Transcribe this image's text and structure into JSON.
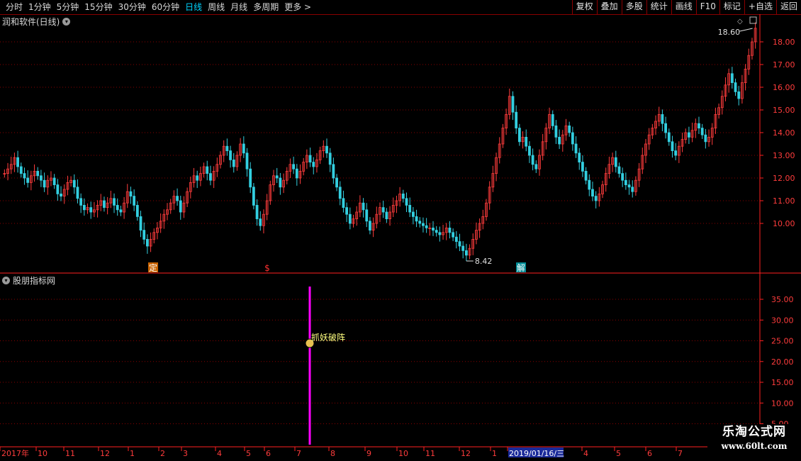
{
  "toolbar": {
    "periods": [
      "分时",
      "1分钟",
      "5分钟",
      "15分钟",
      "30分钟",
      "60分钟",
      "日线",
      "周线",
      "月线",
      "多周期",
      "更多 >"
    ],
    "active_period": "日线",
    "buttons": [
      "复权",
      "叠加",
      "多股",
      "统计",
      "画线",
      "F10",
      "标记",
      "+自选",
      "返回"
    ]
  },
  "main_pane": {
    "title": "润和软件(日线)",
    "high_label": "18.60",
    "low_label": "8.42",
    "markers": [
      {
        "text": "定",
        "color": "#c86400",
        "bg": "#c86400"
      },
      {
        "text": "$",
        "color": "#ff3030",
        "bg": ""
      },
      {
        "text": "解",
        "color": "#00a0a0",
        "bg": "#008c96"
      }
    ],
    "y_ticks": [
      "18.00",
      "17.00",
      "16.00",
      "15.00",
      "14.00",
      "13.00",
      "12.00",
      "11.00",
      "10.00"
    ],
    "colors": {
      "up": "#ff3c3c",
      "down": "#33cfe0",
      "grid": "#8a0000",
      "axis": "#ff2020"
    }
  },
  "indicator_pane": {
    "title": "股朋指标网",
    "y_ticks": [
      "35.00",
      "30.00",
      "25.00",
      "20.00",
      "15.00",
      "10.00",
      "5.00"
    ],
    "signal_label": "抓妖破阵",
    "signal_color": "#ff00ff",
    "label_color": "#ffff80"
  },
  "x_axis": {
    "labels": [
      "2017年",
      "10",
      "11",
      "12",
      "1",
      "2",
      "3",
      "4",
      "5",
      "6",
      "7",
      "8",
      "9",
      "10",
      "11",
      "12",
      "1",
      "2019/01/16/三",
      "4",
      "5",
      "6",
      "7"
    ]
  },
  "watermark": {
    "line1": "乐淘公式网",
    "line2": "www.60lt.com"
  },
  "chart_data": {
    "type": "candlestick",
    "title": "润和软件(日线)",
    "y_range": [
      8.42,
      18.6
    ],
    "annotations": {
      "max": 18.6,
      "min": 8.42
    },
    "closes": [
      12.2,
      12.4,
      12.6,
      12.9,
      12.5,
      12.2,
      12.0,
      11.8,
      12.1,
      12.3,
      12.1,
      11.9,
      11.6,
      11.9,
      12.0,
      11.7,
      11.3,
      11.2,
      11.5,
      11.8,
      11.9,
      11.6,
      11.1,
      10.8,
      10.6,
      10.7,
      10.5,
      10.6,
      10.8,
      11.0,
      10.7,
      10.9,
      11.1,
      10.8,
      10.6,
      10.5,
      10.9,
      11.4,
      11.2,
      10.8,
      10.3,
      9.7,
      9.3,
      9.0,
      9.3,
      9.6,
      9.8,
      10.1,
      10.4,
      10.6,
      10.9,
      11.2,
      11.0,
      10.5,
      10.9,
      11.4,
      11.8,
      12.1,
      11.9,
      12.2,
      12.5,
      12.2,
      11.9,
      12.3,
      12.6,
      13.0,
      13.4,
      13.2,
      12.8,
      12.5,
      13.0,
      13.5,
      13.1,
      12.4,
      11.6,
      10.8,
      10.2,
      9.9,
      10.4,
      11.0,
      11.7,
      12.1,
      12.0,
      11.6,
      11.9,
      12.3,
      12.6,
      12.4,
      12.0,
      12.3,
      12.7,
      13.0,
      12.7,
      12.5,
      12.8,
      13.2,
      13.4,
      13.1,
      12.6,
      12.0,
      11.6,
      11.1,
      10.7,
      10.4,
      10.0,
      10.2,
      10.5,
      10.9,
      10.6,
      10.1,
      9.7,
      10.0,
      10.4,
      10.7,
      10.5,
      10.2,
      10.5,
      10.8,
      11.0,
      11.3,
      11.1,
      10.8,
      10.5,
      10.3,
      10.1,
      10.0,
      9.9,
      9.8,
      9.8,
      9.7,
      9.6,
      9.5,
      9.6,
      9.8,
      9.6,
      9.4,
      9.2,
      9.0,
      8.8,
      8.6,
      8.9,
      9.3,
      9.7,
      10.0,
      10.3,
      10.9,
      11.6,
      12.2,
      12.9,
      13.5,
      14.2,
      14.8,
      15.6,
      14.9,
      14.2,
      13.6,
      13.8,
      13.4,
      13.0,
      12.6,
      12.4,
      13.0,
      13.6,
      14.2,
      14.8,
      14.3,
      13.8,
      13.5,
      13.9,
      14.3,
      14.0,
      13.5,
      13.1,
      12.7,
      12.3,
      11.9,
      11.5,
      11.2,
      11.0,
      11.3,
      11.7,
      12.2,
      12.6,
      12.9,
      12.5,
      12.2,
      11.9,
      11.7,
      11.6,
      11.4,
      11.9,
      12.4,
      13.0,
      13.5,
      13.9,
      14.2,
      14.5,
      14.8,
      14.4,
      14.0,
      13.6,
      13.2,
      13.0,
      13.4,
      13.7,
      14.0,
      13.8,
      14.1,
      14.4,
      14.2,
      13.9,
      13.6,
      13.8,
      14.2,
      14.8,
      15.1,
      15.6,
      16.1,
      16.6,
      16.2,
      15.8,
      15.5,
      16.2,
      16.8,
      17.4,
      18.0,
      18.6
    ]
  }
}
